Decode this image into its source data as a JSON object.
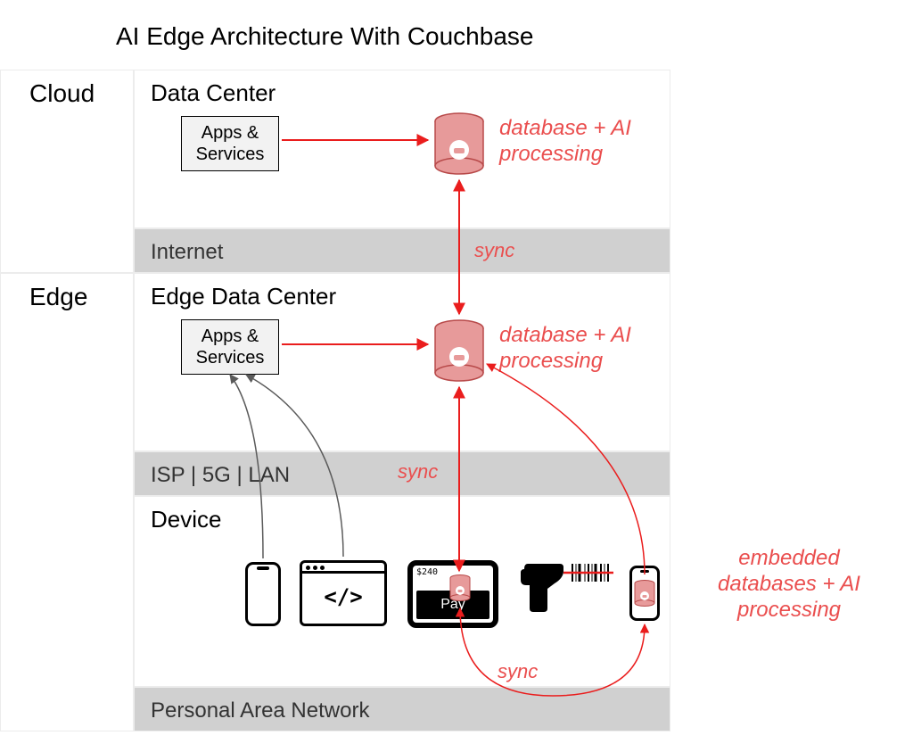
{
  "title": "AI Edge Architecture With Couchbase",
  "tiers": {
    "cloud": {
      "label": "Cloud"
    },
    "edge": {
      "label": "Edge"
    }
  },
  "sections": {
    "data_center": {
      "title": "Data Center",
      "apps_box": "Apps &\nServices"
    },
    "edge_data_center": {
      "title": "Edge Data Center",
      "apps_box": "Apps &\nServices"
    },
    "device": {
      "title": "Device"
    }
  },
  "bands": {
    "internet": "Internet",
    "isp": "ISP | 5G | LAN",
    "pan": "Personal Area Network"
  },
  "labels": {
    "db_ai_1": "database + AI\nprocessing",
    "db_ai_2": "database + AI\nprocessing",
    "embedded": "embedded\ndatabases + AI\nprocessing",
    "sync_1": "sync",
    "sync_2": "sync",
    "sync_3": "sync"
  },
  "devices": {
    "browser_code": "</>",
    "tablet_price": "$240",
    "tablet_button": "Pay"
  },
  "colors": {
    "red": "#ea1d1d",
    "red_fill": "#e79a9a",
    "band": "#d0d0d0",
    "gray_line": "#5a5a5a"
  }
}
